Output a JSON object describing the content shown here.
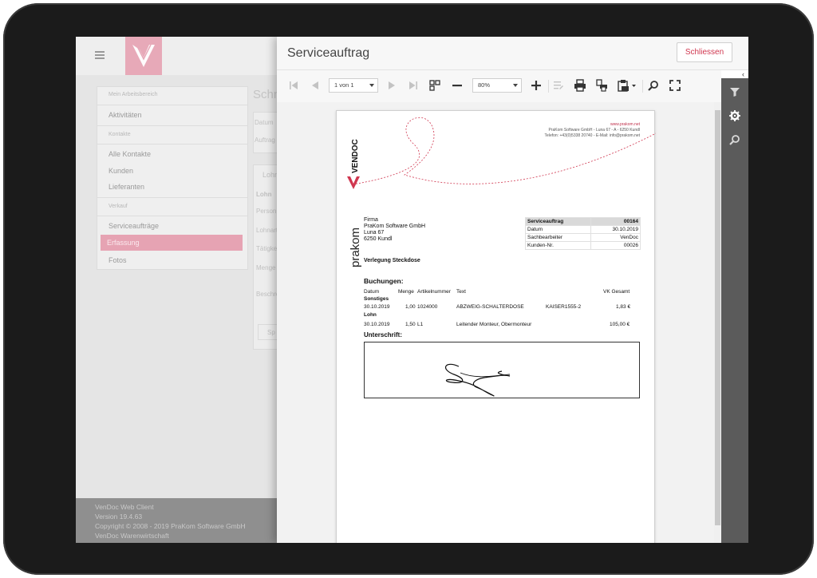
{
  "background_app": {
    "menu": [
      {
        "label": "Mein Arbeitsbereich",
        "type": "section"
      },
      {
        "label": "Aktivitäten",
        "type": "item"
      },
      {
        "label": "Kontakte",
        "type": "section"
      },
      {
        "label": "Alle Kontakte",
        "type": "item"
      },
      {
        "label": "Kunden",
        "type": "item"
      },
      {
        "label": "Lieferanten",
        "type": "item"
      },
      {
        "label": "Verkauf",
        "type": "section"
      },
      {
        "label": "Serviceaufträge",
        "type": "item"
      },
      {
        "label": "Erfassung",
        "type": "active"
      },
      {
        "label": "Fotos",
        "type": "item"
      }
    ],
    "form_title": "Schn",
    "form_labels": [
      "Datum",
      "Auftrag",
      "Lohn",
      "Lohn",
      "Person",
      "Lohnart",
      "Tätigkeit",
      "Menge",
      "Beschreib",
      "Sp"
    ],
    "footer": [
      "VenDoc Web Client",
      "Version 19.4.63",
      "Copyright © 2008 - 2019 PraKom Software GmbH",
      "VenDoc Warenwirtschaft"
    ]
  },
  "modal": {
    "title": "Serviceauftrag",
    "close_label": "Schliessen",
    "toolbar": {
      "page_select": "1 von 1",
      "zoom_select": "80%"
    }
  },
  "document": {
    "header": {
      "url": "www.prakom.net",
      "line1": "PraKom Software GmbH - Luna 67 - A - 6250 Kundl",
      "line2": "Telefon: +43(0)5338 20740 - E-Mail: info@prakom.net"
    },
    "logo_vendoc": "VENDOC",
    "logo_prakom": "prakom",
    "address": [
      "Firma",
      "PraKom Software GmbH",
      "Luna 67",
      "6250 Kundl"
    ],
    "info": {
      "rows": [
        {
          "label": "Serviceauftrag",
          "value": "00164"
        },
        {
          "label": "Datum",
          "value": "30.10.2019"
        },
        {
          "label": "Sachbearbeiter",
          "value": "VenDoc"
        },
        {
          "label": "Kunden-Nr.",
          "value": "00026"
        }
      ]
    },
    "subject": "Verlegung Steckdose",
    "bookings_title": "Buchungen:",
    "columns": {
      "datum": "Datum",
      "menge": "Menge",
      "artikel": "Artikelnummer",
      "text": "Text",
      "vk": "VK Gesamt"
    },
    "group1": "Sonstiges",
    "row1": {
      "datum": "30.10.2019",
      "menge": "1,00",
      "artikel": "1024000",
      "text": "ABZWEIG-SCHALTERDOSE",
      "extra": "KAISER1555-2",
      "vk": "1,83 €"
    },
    "group2": "Lohn",
    "row2": {
      "datum": "30.10.2019",
      "menge": "1,50",
      "artikel": "L1",
      "text": "Leitender Monteur, Obermonteur",
      "vk": "105,00 €"
    },
    "signature_title": "Unterschrift:"
  },
  "colors": {
    "accent": "#d0364f",
    "brand_pink": "#e7a9b8",
    "rail": "#5b5b5b"
  }
}
